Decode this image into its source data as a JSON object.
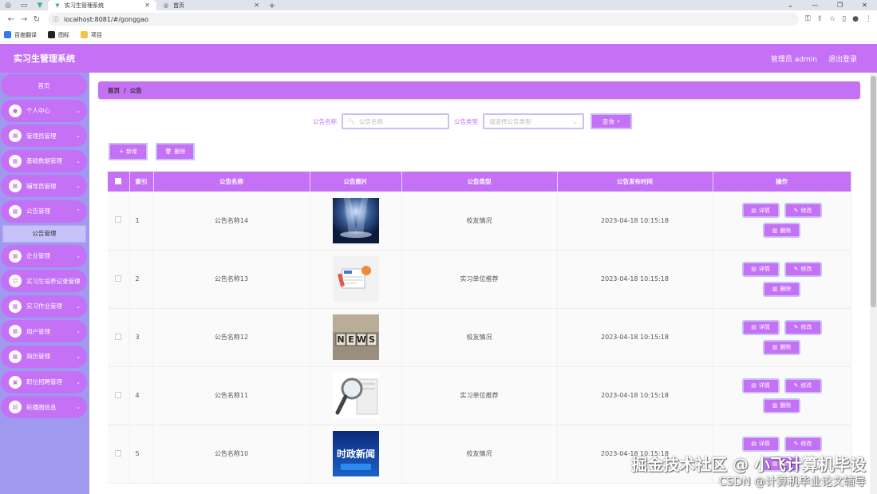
{
  "browser": {
    "tabs": [
      {
        "title": "实习生管理系统",
        "active": true
      },
      {
        "title": "首页",
        "active": false
      }
    ],
    "url": "localhost:8081/#/gonggao",
    "bookmarks": [
      "百度翻译",
      "图标",
      "项目"
    ]
  },
  "header": {
    "title": "实习生管理系统",
    "user_label": "管理员 admin",
    "logout_label": "退出登录"
  },
  "sidebar": {
    "home": "首页",
    "items": [
      {
        "label": "个人中心",
        "icon": "user-icon"
      },
      {
        "label": "管理员管理",
        "icon": "grid-icon"
      },
      {
        "label": "基础数据管理",
        "icon": "grid-icon"
      },
      {
        "label": "辅导员管理",
        "icon": "grid-icon"
      },
      {
        "label": "公告管理",
        "icon": "grid-icon",
        "expanded": true
      },
      {
        "label": "企业管理",
        "icon": "grid-icon"
      },
      {
        "label": "实习生培养记录管理",
        "icon": "person-icon"
      },
      {
        "label": "实习作业管理",
        "icon": "grid-icon"
      },
      {
        "label": "用户管理",
        "icon": "grid-icon"
      },
      {
        "label": "简历管理",
        "icon": "grid-icon"
      },
      {
        "label": "职位招聘管理",
        "icon": "briefcase-icon"
      },
      {
        "label": "轮播图信息",
        "icon": "image-icon"
      }
    ],
    "sub_item": "公告管理"
  },
  "breadcrumb": {
    "home": "首页",
    "separator": "/",
    "current": "公告"
  },
  "search": {
    "name_label": "公告名称",
    "name_placeholder": "公告名称",
    "type_label": "公告类型",
    "type_placeholder": "请选择公告类型",
    "button": "查询"
  },
  "actions": {
    "add": "新增",
    "delete": "删除"
  },
  "table": {
    "headers": [
      "索引",
      "公告名称",
      "公告图片",
      "公告类型",
      "公告发布时间",
      "操作"
    ],
    "rows": [
      {
        "index": "1",
        "name": "公告名称14",
        "type": "校友情况",
        "time": "2023-04-18 10:15:18",
        "image": "stage-spotlight"
      },
      {
        "index": "2",
        "name": "公告名称13",
        "type": "实习单位推荐",
        "time": "2023-04-18 10:15:18",
        "image": "news-illustration"
      },
      {
        "index": "3",
        "name": "公告名称12",
        "type": "校友情况",
        "time": "2023-04-18 10:15:18",
        "image": "news-blocks"
      },
      {
        "index": "4",
        "name": "公告名称11",
        "type": "实习单位推荐",
        "time": "2023-04-18 10:15:18",
        "image": "magnifier-newspaper"
      },
      {
        "index": "5",
        "name": "公告名称10",
        "type": "校友情况",
        "time": "2023-04-18 10:15:18",
        "image": "shizheng-news"
      }
    ],
    "op_labels": {
      "detail": "详情",
      "edit": "修改",
      "delete": "删除"
    }
  },
  "thumb_text": {
    "news": "NEWS",
    "shizheng": "时政新闻"
  },
  "watermark": {
    "line1": "掘金技术社区 @ 小飞计算机毕设",
    "line2": "CSDN @计算机毕业论文辅导"
  },
  "colors": {
    "primary": "#c471f5",
    "sidebar": "#9f9af0",
    "button_border": "#c8c0f8"
  }
}
